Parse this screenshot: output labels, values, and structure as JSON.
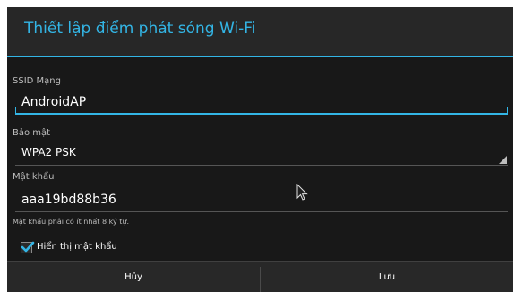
{
  "dialog": {
    "title": "Thiết lập điểm phát sóng Wi-Fi"
  },
  "ssid": {
    "label": "SSID Mạng",
    "value": "AndroidAP"
  },
  "security": {
    "label": "Bảo mật",
    "selected": "WPA2 PSK"
  },
  "password": {
    "label": "Mật khẩu",
    "value": "aaa19bd88b36",
    "hint": "Mật khẩu phải có ít nhất 8 ký tự."
  },
  "show_password": {
    "label": "Hiển thị mật khẩu",
    "checked": true
  },
  "buttons": {
    "cancel": "Hủy",
    "save": "Lưu"
  },
  "colors": {
    "accent": "#33b5e5",
    "background": "#181818",
    "text": "#ffffff"
  },
  "icons": [
    "checkmark-icon",
    "spinner-arrow-icon",
    "mouse-pointer-icon"
  ]
}
